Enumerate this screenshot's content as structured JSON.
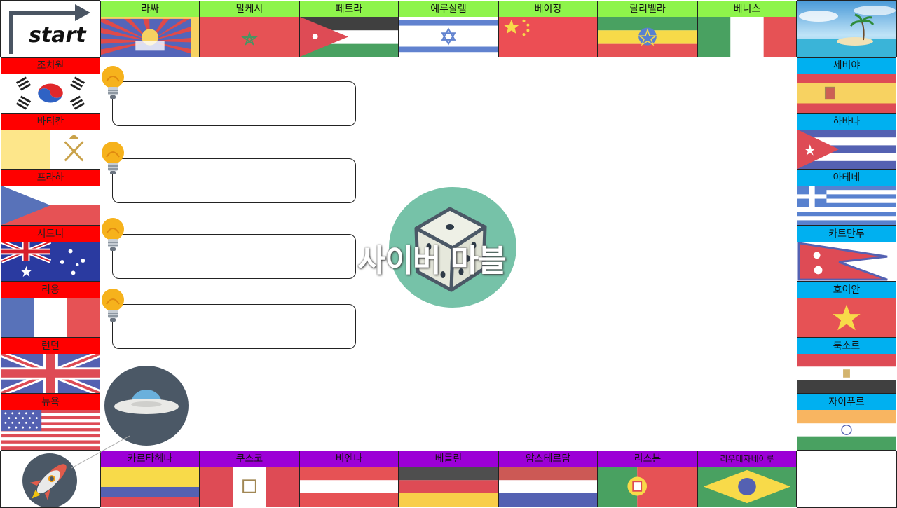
{
  "board": {
    "title": "사이버 마블",
    "start_label": "start",
    "top": [
      "라싸",
      "말케시",
      "페트라",
      "예루살렘",
      "베이징",
      "랄리벨라",
      "베니스"
    ],
    "left": [
      "조치원",
      "바티칸",
      "프라하",
      "시드니",
      "리옹",
      "런던",
      "뉴욕"
    ],
    "right": [
      "세비야",
      "하바나",
      "아테네",
      "카트만두",
      "호이안",
      "룩소르",
      "자이푸르"
    ],
    "bottom": [
      "카르타헤나",
      "쿠스코",
      "비엔나",
      "베를린",
      "암스테르담",
      "리스본",
      "리우데자네이루"
    ]
  },
  "colors": {
    "top_band": "#8ef44b",
    "left_band": "#ff0000",
    "right_band": "#00b0f0",
    "bottom_band": "#9c00d6",
    "dice_circle": "#76c2a8",
    "ufo_circle": "#4b5866",
    "rocket_circle": "#4b5866"
  },
  "icons": [
    "start-arrow-icon",
    "lightbulb-icon",
    "dice-icon",
    "ufo-icon",
    "rocket-icon",
    "island-icon"
  ]
}
